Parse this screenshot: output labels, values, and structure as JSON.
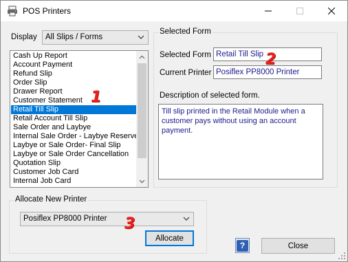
{
  "window": {
    "title": "POS Printers"
  },
  "display": {
    "label": "Display",
    "selected": "All Slips / Forms"
  },
  "slip_list": {
    "items": [
      "Cash Up Report",
      "Account Payment",
      "Refund Slip",
      "Order Slip",
      "Drawer Report",
      "Customer Statement",
      "Retail Till Slip",
      "Retail Account Till Slip",
      "Sale Order and Laybye",
      "Internal Sale Order - Laybye Reserved",
      "Laybye or Sale Order- Final Slip",
      "Laybye or Sale Order Cancellation",
      "Quotation Slip",
      "Customer Job Card",
      "Internal Job Card"
    ],
    "selected_index": 6
  },
  "selected_form_group": {
    "title": "Selected Form",
    "selected_form_label": "Selected Form",
    "selected_form_value": "Retail Till Slip",
    "current_printer_label": "Current Printer",
    "current_printer_value": "Posiflex PP8000 Printer",
    "description_label": "Description of selected form.",
    "description_text": "Till slip printed in the Retail Module when a customer pays without using an account payment."
  },
  "allocate_group": {
    "title": "Allocate New Printer",
    "printer_selected": "Posiflex PP8000 Printer",
    "allocate_label": "Allocate"
  },
  "footer": {
    "help_label": "?",
    "close_label": "Close"
  },
  "markers": {
    "m1": "1",
    "m2": "2",
    "m3": "3"
  },
  "colors": {
    "accent": "#0078d7",
    "value_text": "#1a1a8c",
    "marker": "#e8231f"
  }
}
